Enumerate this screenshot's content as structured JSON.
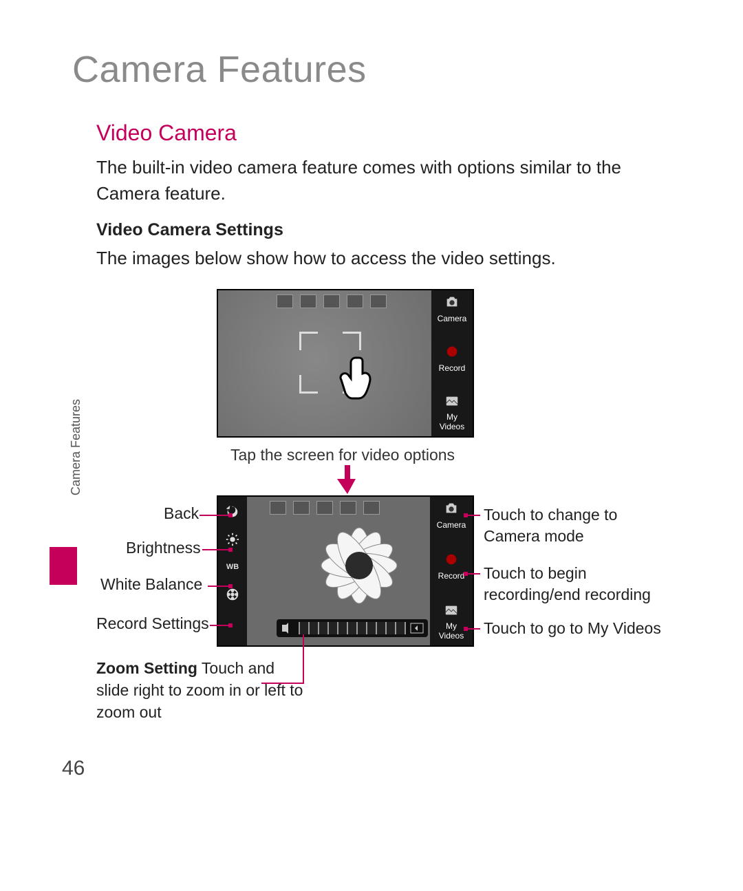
{
  "title": "Camera Features",
  "section_heading": "Video Camera",
  "intro": "The built-in video camera feature comes with options similar to the Camera feature.",
  "sub_heading": "Video Camera Settings",
  "sub_intro": "The images below show how to access the video settings.",
  "side_tab": "Camera Features",
  "page_number": "46",
  "screenshot1": {
    "right": {
      "camera": "Camera",
      "record": "Record",
      "my_videos_line1": "My",
      "my_videos_line2": "Videos"
    },
    "caption": "Tap the screen for video options"
  },
  "screenshot2": {
    "right": {
      "camera": "Camera",
      "record": "Record",
      "my_videos_line1": "My",
      "my_videos_line2": "Videos"
    },
    "left_callouts": {
      "back": "Back",
      "brightness": "Brightness",
      "white_balance": "White Balance",
      "record_settings": "Record Settings"
    },
    "right_callouts": {
      "camera": "Touch to change to Camera mode",
      "record": "Touch to begin recording/end recording",
      "my_videos": "Touch to go to My Videos"
    },
    "zoom": {
      "bold": "Zoom Setting",
      "rest": " Touch and slide right to zoom in or left to zoom out"
    }
  }
}
